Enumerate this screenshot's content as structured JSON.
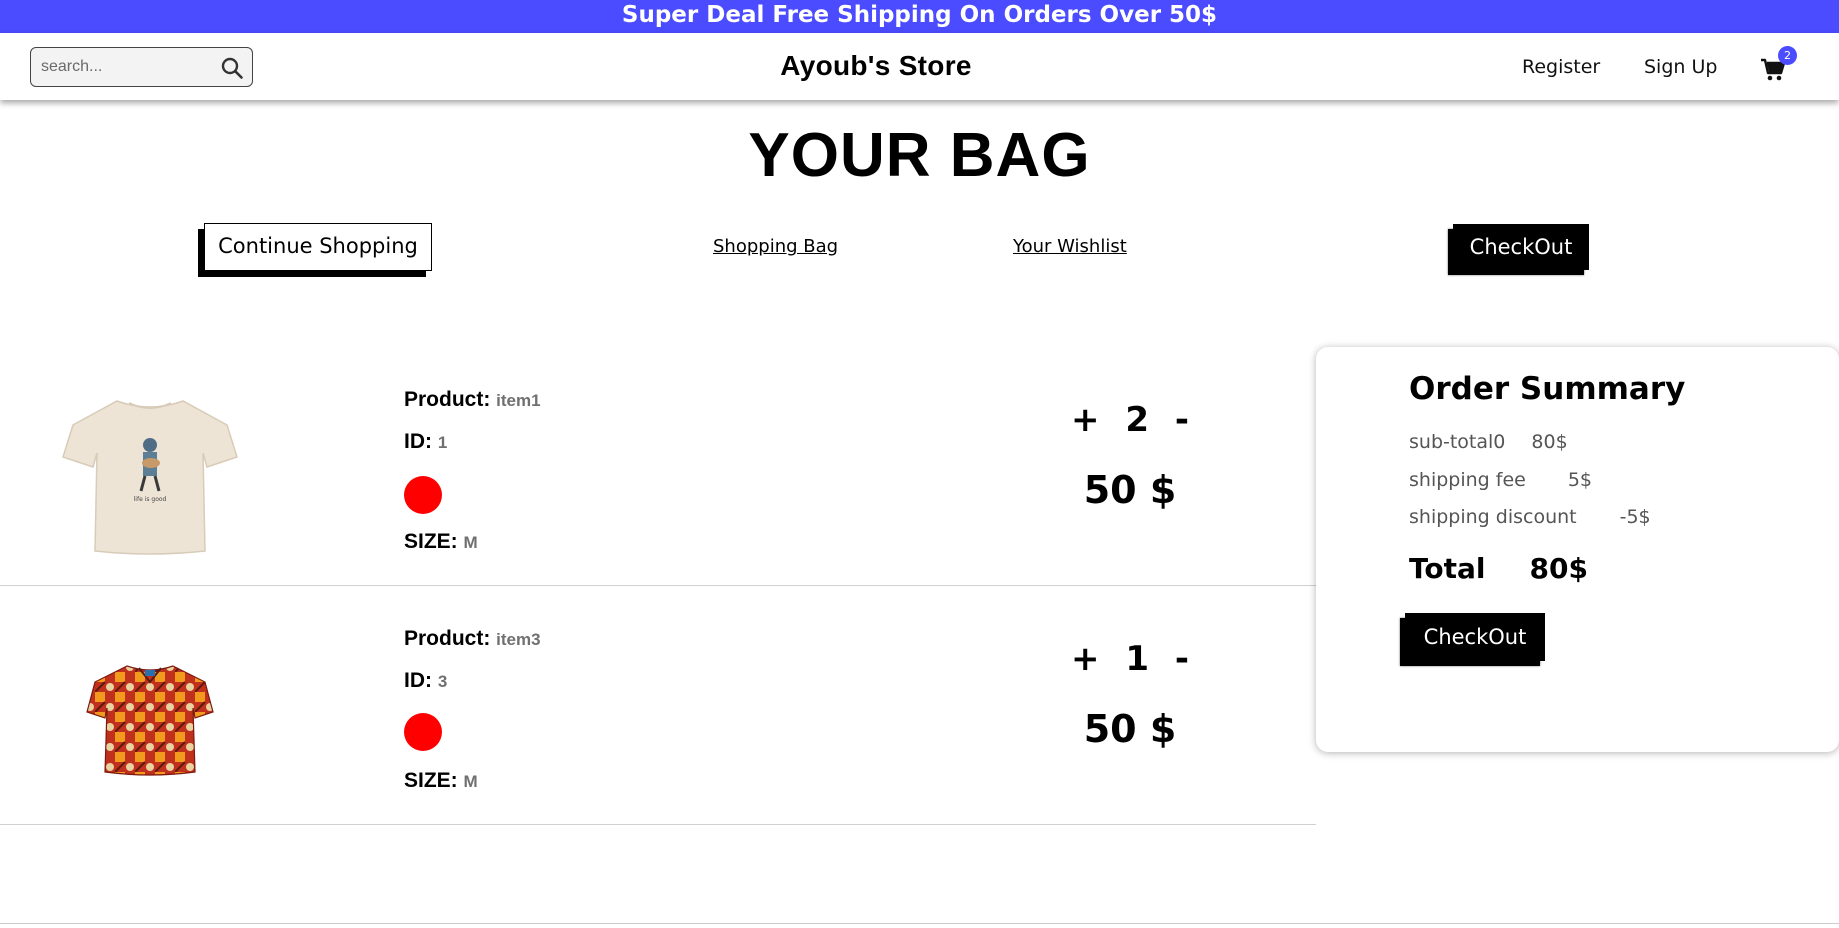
{
  "banner": {
    "text": "Super Deal Free Shipping On Orders Over 50$"
  },
  "navbar": {
    "search": {
      "placeholder": "search...",
      "icon": "search-icon"
    },
    "store_name": "Ayoub's Store",
    "links": {
      "register": "Register",
      "sign_up": "Sign Up"
    },
    "cart": {
      "icon": "cart-icon",
      "badge": "2",
      "badge_color": "#4b4bff"
    }
  },
  "page": {
    "title": "YOUR BAG"
  },
  "top_actions": {
    "continue_shopping": "Continue Shopping",
    "shopping_bag": "Shopping Bag",
    "wishlist": "Your Wishlist",
    "checkout": "CheckOut"
  },
  "items": [
    {
      "image": "beige-tshirt-image",
      "product_label": "Product:",
      "product": "item1",
      "id_label": "ID:",
      "id": "1",
      "color": "#ff0000",
      "size_label": "SIZE:",
      "size": "M",
      "plus": "+",
      "quantity": "2",
      "minus": "-",
      "price": "50 $"
    },
    {
      "image": "patterned-shirt-image",
      "product_label": "Product:",
      "product": "item3",
      "id_label": "ID:",
      "id": "3",
      "color": "#ff0000",
      "size_label": "SIZE:",
      "size": "M",
      "plus": "+",
      "quantity": "1",
      "minus": "-",
      "price": "50 $"
    }
  ],
  "summary": {
    "title": "Order Summary",
    "subtotal_label": "sub-total0",
    "subtotal": "80$",
    "shipping_fee_label": "shipping fee",
    "shipping_fee": "5$",
    "shipping_discount_label": "shipping discount",
    "shipping_discount": "-5$",
    "total_label": "Total",
    "total": "80$",
    "checkout": "CheckOut"
  }
}
